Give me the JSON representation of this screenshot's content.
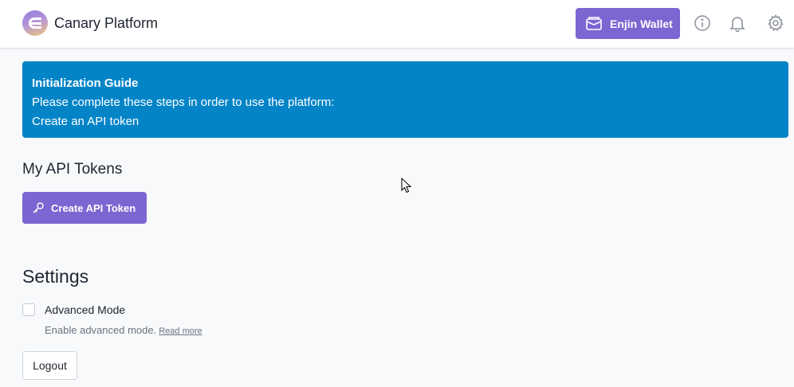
{
  "header": {
    "app_title": "Canary Platform",
    "wallet_button_label": "Enjin Wallet",
    "icons": [
      "wallet-icon",
      "info-icon",
      "bell-icon",
      "gear-icon"
    ],
    "accent_color": "#7c66d1"
  },
  "banner": {
    "title": "Initialization Guide",
    "line1": "Please complete these steps in order to use the platform:",
    "line2": "Create an API token",
    "color": "#0284c7"
  },
  "tokens": {
    "heading": "My API Tokens",
    "create_button_label": "Create API Token",
    "create_icon": "key-icon"
  },
  "settings": {
    "heading": "Settings",
    "advanced_mode_label": "Advanced Mode",
    "advanced_mode_checked": false,
    "advanced_mode_description": "Enable advanced mode.",
    "read_more_label": "Read more",
    "logout_label": "Logout"
  }
}
